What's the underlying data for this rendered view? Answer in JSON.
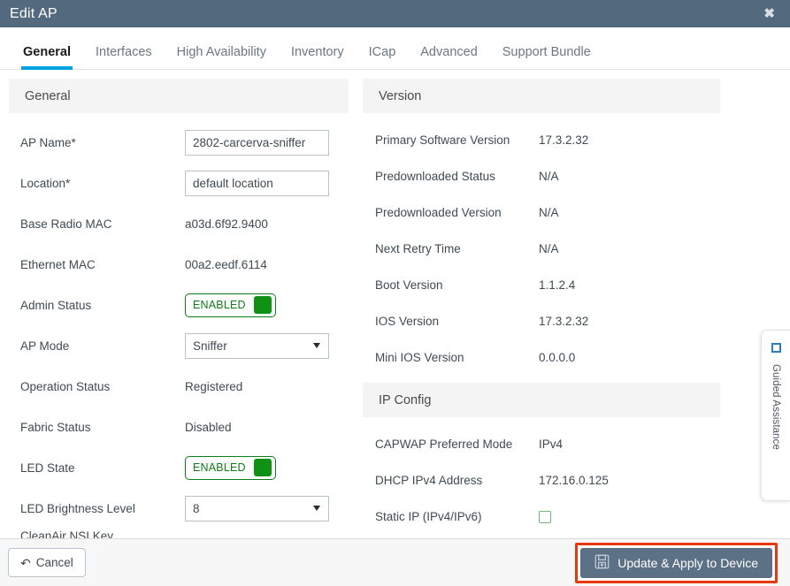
{
  "window": {
    "title": "Edit AP",
    "close_icon": "close-icon"
  },
  "tabs": [
    {
      "label": "General",
      "active": true
    },
    {
      "label": "Interfaces",
      "active": false
    },
    {
      "label": "High Availability",
      "active": false
    },
    {
      "label": "Inventory",
      "active": false
    },
    {
      "label": "ICap",
      "active": false
    },
    {
      "label": "Advanced",
      "active": false
    },
    {
      "label": "Support Bundle",
      "active": false
    }
  ],
  "left_panel": {
    "header": "General",
    "ap_name": {
      "label": "AP Name*",
      "value": "2802-carcerva-sniffer"
    },
    "location": {
      "label": "Location*",
      "value": "default location"
    },
    "base_radio_mac": {
      "label": "Base Radio MAC",
      "value": "a03d.6f92.9400"
    },
    "ethernet_mac": {
      "label": "Ethernet MAC",
      "value": "00a2.eedf.6114"
    },
    "admin_status": {
      "label": "Admin Status",
      "value": "ENABLED"
    },
    "ap_mode": {
      "label": "AP Mode",
      "value": "Sniffer"
    },
    "operation_status": {
      "label": "Operation Status",
      "value": "Registered"
    },
    "fabric_status": {
      "label": "Fabric Status",
      "value": "Disabled"
    },
    "led_state": {
      "label": "LED State",
      "value": "ENABLED"
    },
    "led_brightness": {
      "label": "LED Brightness Level",
      "value": "8"
    },
    "clipped": {
      "label": "CleanAir NSI Key"
    }
  },
  "right_panel": {
    "version_header": "Version",
    "primary_software_version": {
      "label": "Primary Software Version",
      "value": "17.3.2.32"
    },
    "predownloaded_status": {
      "label": "Predownloaded Status",
      "value": "N/A"
    },
    "predownloaded_version": {
      "label": "Predownloaded Version",
      "value": "N/A"
    },
    "next_retry_time": {
      "label": "Next Retry Time",
      "value": "N/A"
    },
    "boot_version": {
      "label": "Boot Version",
      "value": "1.1.2.4"
    },
    "ios_version": {
      "label": "IOS Version",
      "value": "17.3.2.32"
    },
    "mini_ios_version": {
      "label": "Mini IOS Version",
      "value": "0.0.0.0"
    },
    "ip_config_header": "IP Config",
    "capwap_preferred_mode": {
      "label": "CAPWAP Preferred Mode",
      "value": "IPv4"
    },
    "dhcp_ipv4_address": {
      "label": "DHCP IPv4 Address",
      "value": "172.16.0.125"
    },
    "static_ip": {
      "label": "Static IP (IPv4/IPv6)",
      "checked": false
    }
  },
  "guided_assistance": {
    "label": "Guided Assistance",
    "icon": "square-outline-icon"
  },
  "footer": {
    "cancel_label": "Cancel",
    "cancel_icon": "undo-arrow-icon",
    "update_label": "Update & Apply to Device",
    "update_icon": "save-floppy-icon"
  },
  "colors": {
    "titlebar": "#53697d",
    "accent_tab": "#00a3e0",
    "toggle_green": "#0f9113",
    "toggle_border_green": "#0f7c18",
    "highlight_red": "#e8380d",
    "primary_button": "#5c7185",
    "panel_header_bg": "#f4f4f4",
    "checkbox_green": "#76b479"
  }
}
